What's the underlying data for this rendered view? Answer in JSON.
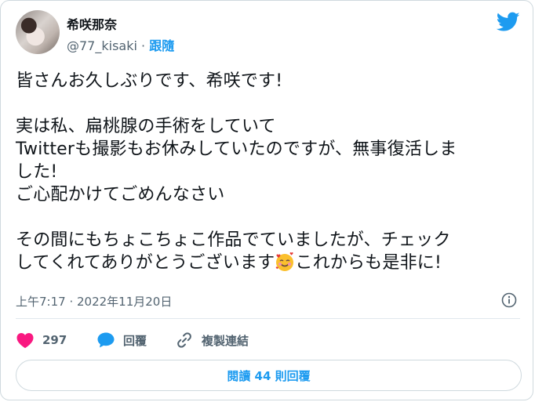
{
  "author": {
    "display_name": "希咲那奈",
    "handle": "@77_kisaki",
    "separator": " · ",
    "follow_label": "跟隨"
  },
  "tweet": {
    "text_before_emoji": "皆さんお久しぶりです、希咲です!\n\n実は私、扁桃腺の手術をしていて\nTwitterも撮影もお休みしていたのですが、無事復活しま\nした!\nご心配かけてごめんなさい\n\nその間にもちょこちょこ作品でていましたが、チェック\nしてくれてありがとうございます",
    "emoji_name": "smiling-face-with-hearts",
    "text_after_emoji": "これからも是非に!",
    "timestamp": "上午7:17 · 2022年11月20日"
  },
  "actions": {
    "like_count": "297",
    "reply_label": "回覆",
    "copy_link_label": "複製連結"
  },
  "read_replies_label": "閱讀 44 則回覆",
  "colors": {
    "accent": "#1d9bf0",
    "like": "#f91880",
    "muted": "#536471"
  },
  "icons": [
    "twitter-bird-icon",
    "info-icon",
    "heart-icon",
    "reply-bubble-icon",
    "link-icon"
  ]
}
